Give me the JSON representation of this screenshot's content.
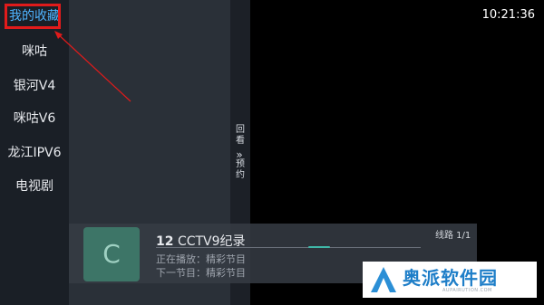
{
  "status_bar": {
    "time": "10:21:36"
  },
  "categories": [
    {
      "label": "我的收藏",
      "selected": true
    },
    {
      "label": "咪咕",
      "selected": false
    },
    {
      "label": "银河V4",
      "selected": false
    },
    {
      "label": "咪咕V6",
      "selected": false
    },
    {
      "label": "龙江IPV6",
      "selected": false
    },
    {
      "label": "电视剧",
      "selected": false
    }
  ],
  "side_tabs": {
    "replay": [
      "回",
      "看"
    ],
    "schedule": [
      "预",
      "约"
    ]
  },
  "now_playing": {
    "logo_letter": "C",
    "channel_number": "12",
    "channel_name": "CCTV9纪录",
    "current_program": "正在播放：精彩节目",
    "next_program": "下一节目：精彩节目",
    "line_info": "线路 1/1"
  },
  "watermark": {
    "name": "奥派软件园",
    "subtitle": "AUPAIRUTION.COM"
  },
  "colors": {
    "selected_text": "#4fb4ff",
    "annotation_red": "#e01b1b",
    "logo_bg": "#3d7567",
    "watermark_blue": "#1e7ec8"
  }
}
